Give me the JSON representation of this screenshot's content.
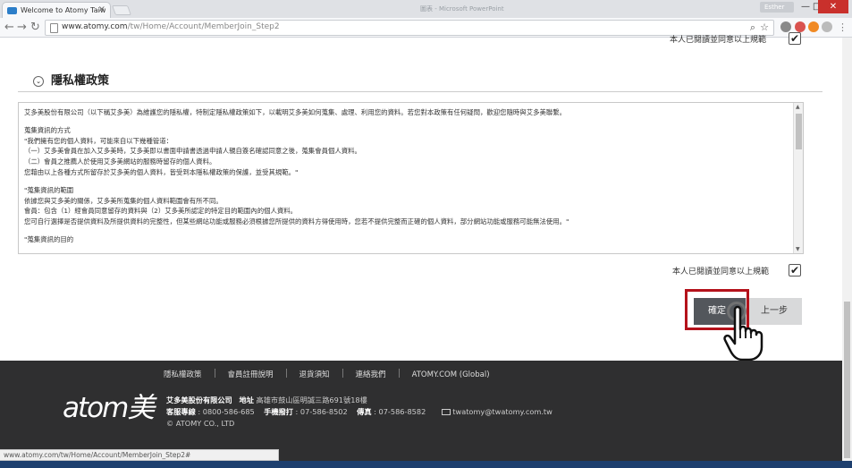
{
  "browser": {
    "tab_title": "Welcome to Atomy Taiw",
    "tab_close": "×",
    "ghost_title": "圖表 - Microsoft PowerPoint",
    "user": "Esther",
    "url_host": "www.atomy.com",
    "url_path": "/tw/Home/Account/MemberJoin_Step2",
    "min": "—",
    "max": "□",
    "close": "✕"
  },
  "page": {
    "top_agree_label": "本人已閱讀並同意以上規範",
    "section_title": "隱私權政策",
    "policy_lines": [
      "艾多美股份有限公司（以下稱艾多美）為維護您的隱私權，特制定隱私權政策如下，以載明艾多美如何蒐集、處理、利用您的資料。若您對本政策有任何疑問，歡迎您隨時與艾多美聯繫。",
      "",
      "蒐集資訊的方式",
      "\"我們擁有您的個人資料，可能來自以下幾種管道：",
      "（一）艾多美會員在加入艾多美時，艾多美即以書面申請書透過申請人親自簽名確認同意之後，蒐集會員個人資料。",
      "（二）會員之推薦人於使用艾多美網站的服務時留存的個人資料。",
      "您藉由以上各種方式所留存於艾多美的個人資料，皆受到本隱私權政策的保護，並受其規範。\"",
      "",
      "\"蒐集資訊的範圍",
      "依據您與艾多美的關係，艾多美所蒐集的個人資料範圍會有所不同。",
      "會員：包含（1）經會員同意留存的資料與（2）艾多美所認定的特定目的範圍內的個人資料。",
      "您可自行選擇是否提供資料及所提供資料的完整性，但某些網站功能或服務必須根據您所提供的資料方得使用時，您若不提供完整而正確的個人資料，部分網站功能或服務可能無法使用。\"",
      "",
      "\"蒐集資訊的目的"
    ],
    "bottom_agree_label": "本人已閱讀並同意以上規範",
    "confirm_label": "確定",
    "prev_label": "上一步",
    "check_mark": "✔"
  },
  "footer": {
    "nav": [
      "隱私權政策",
      "會員註冊說明",
      "退貨須知",
      "連絡我們",
      "ATOMY.COM (Global)"
    ],
    "logo": "atom美",
    "company": "艾多美股份有限公司",
    "address_label": "地址",
    "address": "高雄市鼓山區明誠三路691號18樓",
    "service_label": "客服專線",
    "service_phone": "0800-586-685",
    "mobile_label": "手機撥打",
    "mobile_phone": "07-586-8502",
    "fax_label": "傳真",
    "fax": "07-586-8582",
    "email": "twatomy@twatomy.com.tw",
    "copyright": "© ATOMY CO., LTD"
  },
  "status_url": "www.atomy.com/tw/Home/Account/MemberJoin_Step2#"
}
